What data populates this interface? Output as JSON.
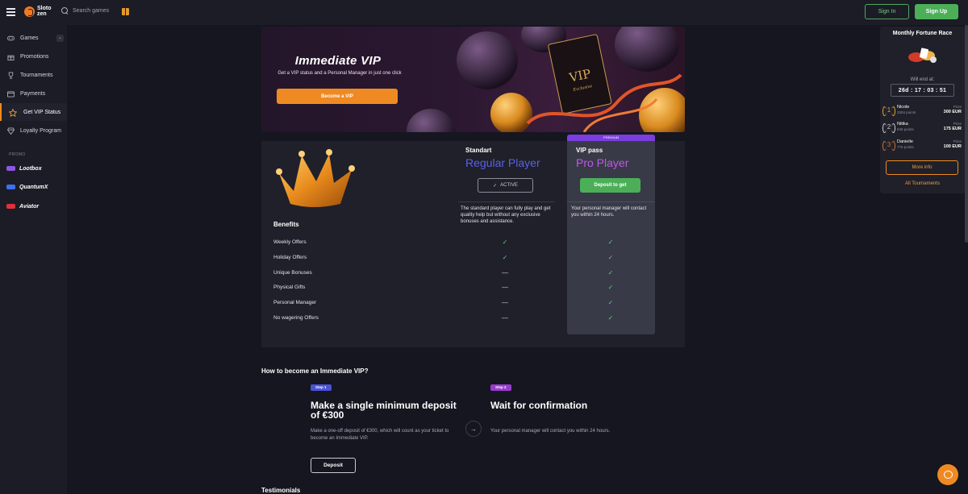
{
  "header": {
    "logo_line1": "Sloto",
    "logo_line2": "zen",
    "search_placeholder": "Search games",
    "signin_label": "Sign In",
    "signup_label": "Sign Up"
  },
  "sidebar": {
    "items": [
      {
        "label": "Games",
        "icon": "gamepad-icon"
      },
      {
        "label": "Promotions",
        "icon": "gift-icon"
      },
      {
        "label": "Tournaments",
        "icon": "trophy-icon"
      },
      {
        "label": "Payments",
        "icon": "wallet-icon"
      },
      {
        "label": "Get VIP Status",
        "icon": "star-icon"
      },
      {
        "label": "Loyalty Program",
        "icon": "diamond-icon"
      }
    ],
    "promo_label": "PROMO",
    "promo_items": [
      {
        "label": "Lootbox",
        "color": "#8d56e6"
      },
      {
        "label": "QuantumX",
        "color": "#3e6ff2"
      },
      {
        "label": "Aviator",
        "color": "#e0303a"
      }
    ]
  },
  "hero": {
    "title": "Immediate VIP",
    "text": "Get a VIP status and a Personal Manager in just one click",
    "button": "Become a VIP",
    "card_text": "VIP",
    "card_sub": "Exclusive"
  },
  "comparison": {
    "standard": {
      "small": "Standart",
      "big": "Regular Player",
      "button": "ACTIVE",
      "desc": "The standard player can fully play and get quality help but without any exclusive bonuses and assistance."
    },
    "vip": {
      "badge": "PREMIUM",
      "small": "VIP pass",
      "big": "Pro Player",
      "button": "Deposit to get",
      "desc": "Your personal manager will contact you within 24 hours."
    },
    "benefits_title": "Benefits",
    "benefits": [
      {
        "name": "Weekly Offers",
        "standard": "✓",
        "vip": "✓"
      },
      {
        "name": "Holiday Offers",
        "standard": "✓",
        "vip": "✓"
      },
      {
        "name": "Unique Bonuses",
        "standard": "—",
        "vip": "✓"
      },
      {
        "name": "Physical Gifts",
        "standard": "—",
        "vip": "✓"
      },
      {
        "name": "Personal Manager",
        "standard": "—",
        "vip": "✓"
      },
      {
        "name": "No wagering Offers",
        "standard": "—",
        "vip": "✓"
      }
    ]
  },
  "how": {
    "title": "How to become an Immediate VIP?",
    "step1": {
      "pill": "Step 1",
      "title": "Make a single minimum deposit of €300",
      "text": "Make a one-off deposit of €300, which will count as your ticket to become an Immediate VIP.",
      "button": "Deposit"
    },
    "step2": {
      "pill": "Step 2",
      "title": "Wait for confirmation",
      "text": "Your personal manager will contact you within 24 hours."
    },
    "arrow": "→"
  },
  "testimonials_title": "Testimonials",
  "race": {
    "title": "Monthly Fortune Race",
    "end_label": "Will end at:",
    "timer": "26d : 17 : 03 : 51",
    "prize_label": "Prize",
    "places": [
      {
        "num": "1",
        "name": "Nicole",
        "points": "3304 points",
        "prize": "300 EUR",
        "color": "#e3a43a"
      },
      {
        "num": "2",
        "name": "Nitika",
        "points": "945 points",
        "prize": "175 EUR",
        "color": "#d0d1d8"
      },
      {
        "num": "3",
        "name": "Danielle",
        "points": "775 points",
        "prize": "100 EUR",
        "color": "#c6763a"
      }
    ],
    "more_button": "More info",
    "all_link": "All Tournaments"
  }
}
